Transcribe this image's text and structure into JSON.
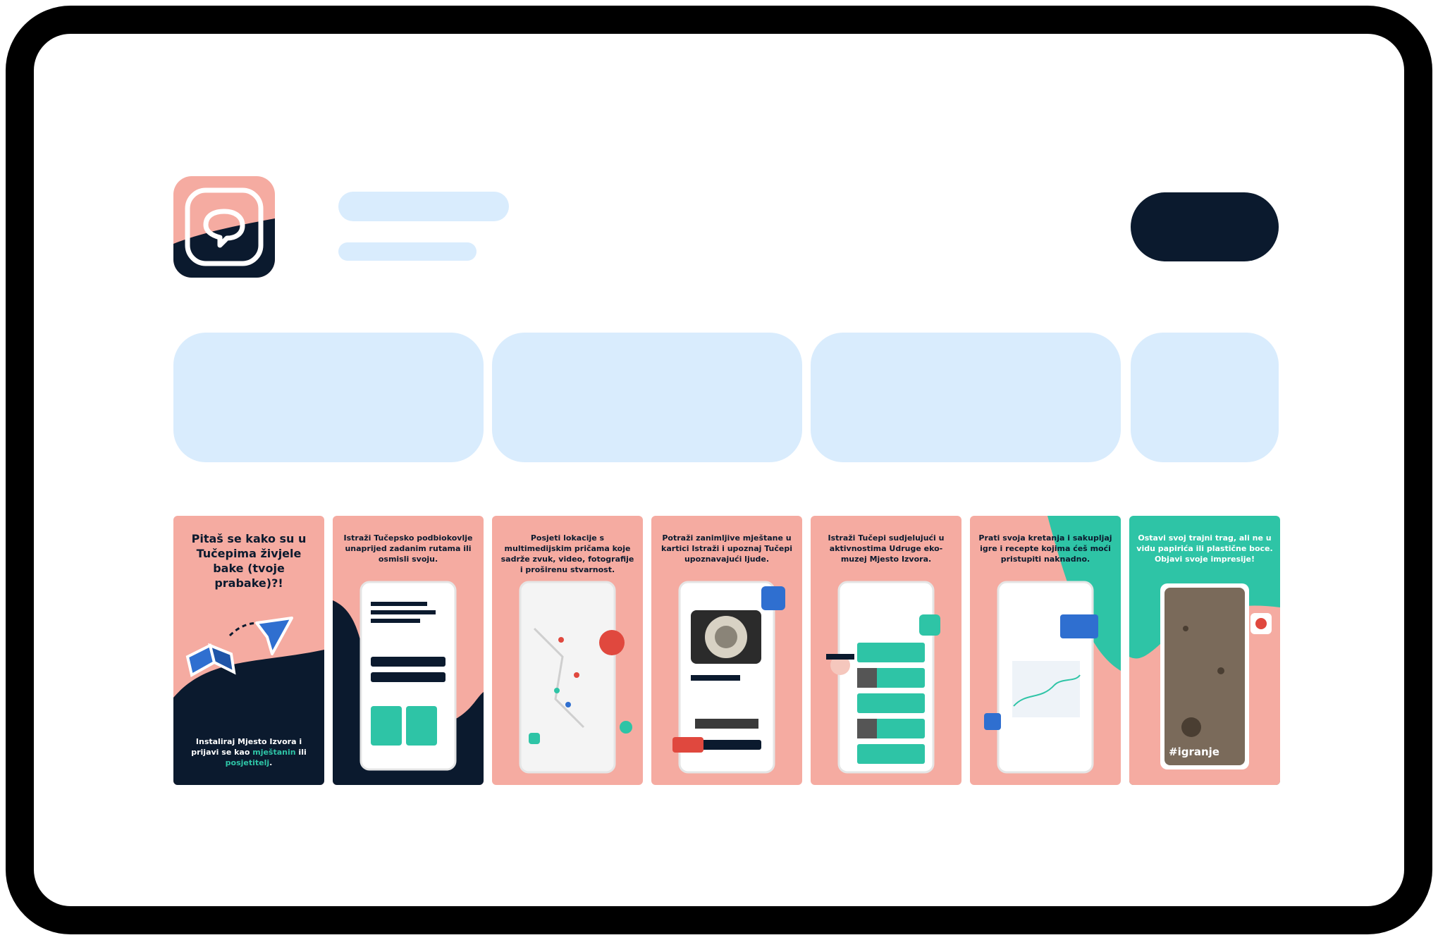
{
  "app": {
    "icon_name": "chat-bubble-app-icon",
    "brand_colors": {
      "pink": "#f5aba1",
      "navy": "#0b1a2e",
      "teal": "#2ec4a6",
      "placeholder": "#d9ecfd"
    }
  },
  "screenshots": [
    {
      "caption": "Pitaš se kako su u Tučepima živjele bake (tvoje prabake)?!",
      "footer_before": "Instaliraj Mjesto Izvora i prijavi se kao ",
      "footer_link1": "mještanin",
      "footer_mid": " ili ",
      "footer_link2": "posjetitelj",
      "footer_after": "."
    },
    {
      "caption": "Istraži Tučepsko podbiokovlje unaprijed zadanim rutama ili osmisli svoju."
    },
    {
      "caption": "Posjeti lokacije s multimedijskim pričama koje sadrže zvuk, video, fotografije i proširenu stvarnost."
    },
    {
      "caption": "Potraži zanimljive mještane u kartici Istraži i upoznaj Tučepi upoznavajući ljude."
    },
    {
      "caption": "Istraži Tučepi sudjelujući u aktivnostima Udruge eko-muzej Mjesto Izvora."
    },
    {
      "caption": "Prati svoja kretanja i sakupljaj igre i recepte kojima ćeš moći pristupiti naknadno."
    },
    {
      "caption": "Ostavi svoj trajni trag, ali ne u vidu papirića ili plastične boce. Objavi svoje impresije!",
      "hashtag": "#igranje"
    }
  ]
}
